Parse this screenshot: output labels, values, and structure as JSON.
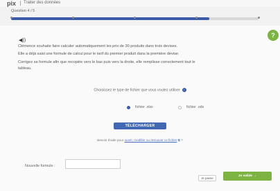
{
  "header": {
    "logo": "pix",
    "app_title": "Traiter des données"
  },
  "question": {
    "label": "Question 4 / 5",
    "progress": 0.8,
    "dots": 5
  },
  "help_button_label": "?",
  "audio_icon": "audio-icon",
  "instructions": {
    "line1": "Clémence souhaite faire calculer automatiquement les prix de 30 produits dans trois devises.",
    "line2": "Elle a déjà saisi une formule de calcul pour le tarif du premier produit dans la première devise.",
    "line3": "Corrigez sa formule afin que recopiée vers le bas puis vers la droite, elle remplisse correctement tout le",
    "line4": "tableau."
  },
  "file_choice": {
    "prompt": "Choisissez le type de fichier que vous voulez utiliser",
    "info_icon": "i",
    "options": [
      {
        "label": "fichier .xlsx",
        "selected": true
      },
      {
        "label": "fichier .ods",
        "selected": false
      }
    ],
    "download_label": "TÉLÉCHARGER"
  },
  "help_text": {
    "prefix": "Besoin d'aide pour",
    "link": "ouvrir, modifier ou retrouver ce fichier",
    "suffix": "?"
  },
  "answer": {
    "label": "Nouvelle formule :",
    "value": ""
  },
  "actions": {
    "skip_label": "Je passe",
    "validate_label": "Je valide →"
  },
  "colors": {
    "accent": "#3a5ca8",
    "validate": "#7cb342"
  }
}
